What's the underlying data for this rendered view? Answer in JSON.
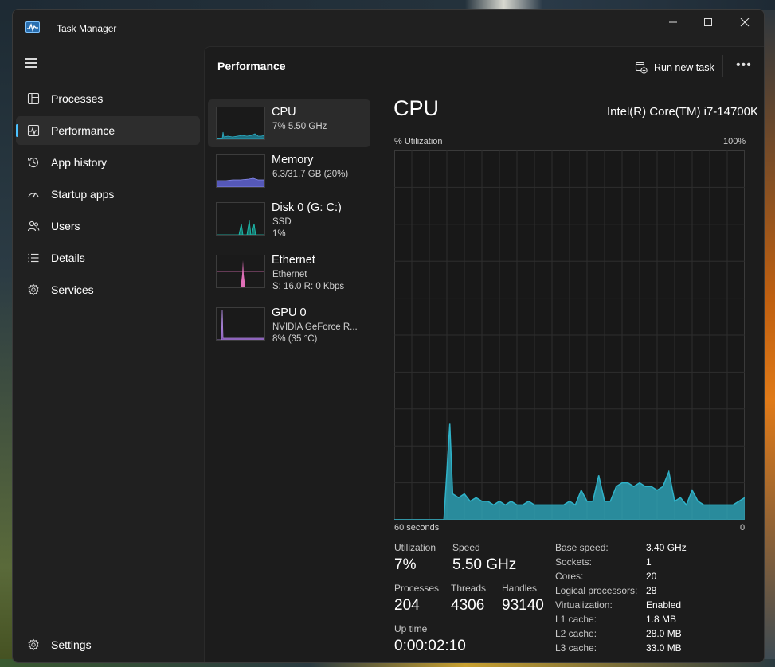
{
  "app": {
    "title": "Task Manager"
  },
  "window_controls": {
    "minimize": "—",
    "maximize": "☐",
    "close": "✕"
  },
  "sidebar": {
    "items": [
      {
        "label": "Processes",
        "icon": "processes-icon"
      },
      {
        "label": "Performance",
        "icon": "performance-icon",
        "active": true
      },
      {
        "label": "App history",
        "icon": "history-icon"
      },
      {
        "label": "Startup apps",
        "icon": "startup-icon"
      },
      {
        "label": "Users",
        "icon": "users-icon"
      },
      {
        "label": "Details",
        "icon": "details-icon"
      },
      {
        "label": "Services",
        "icon": "services-icon"
      }
    ],
    "settings": {
      "label": "Settings",
      "icon": "gear-icon"
    }
  },
  "header": {
    "title": "Performance",
    "run_new_task": "Run new task",
    "more": "•••"
  },
  "resources": [
    {
      "name": "CPU",
      "line1": "7%  5.50 GHz",
      "line2": "",
      "color": "#2fb2c8"
    },
    {
      "name": "Memory",
      "line1": "6.3/31.7 GB (20%)",
      "line2": "",
      "color": "#6b6fd8"
    },
    {
      "name": "Disk 0 (G: C:)",
      "line1": "SSD",
      "line2": "1%",
      "color": "#1fa59a"
    },
    {
      "name": "Ethernet",
      "line1": "Ethernet",
      "line2": "S: 16.0  R: 0 Kbps",
      "color": "#e06fb8"
    },
    {
      "name": "GPU 0",
      "line1": "NVIDIA GeForce R...",
      "line2": "8%  (35 °C)",
      "color": "#9a68c8"
    }
  ],
  "cpu": {
    "title": "CPU",
    "model": "Intel(R) Core(TM) i7-14700K",
    "y_label": "% Utilization",
    "y_max_label": "100%",
    "x_left_label": "60 seconds",
    "x_right_label": "0"
  },
  "chart_data": {
    "type": "area",
    "title": "",
    "xlabel": "60 seconds",
    "ylabel": "% Utilization",
    "ylim": [
      0,
      100
    ],
    "xlim": [
      60,
      0
    ],
    "grid": true,
    "series": [
      {
        "color": "#2fb2c8",
        "x": [
          60,
          58,
          56,
          54,
          52,
          51.5,
          50.5,
          50,
          49,
          48,
          47,
          46,
          45,
          44,
          43,
          42,
          41,
          40,
          39,
          38,
          37,
          36,
          35,
          34,
          33,
          32,
          31,
          30,
          29,
          28,
          27,
          26,
          25,
          24,
          23,
          22,
          21,
          20,
          19,
          18,
          17,
          16,
          15,
          14,
          13,
          12,
          11,
          10,
          9,
          8,
          7,
          6,
          5,
          4,
          3,
          2,
          1,
          0
        ],
        "y": [
          0,
          0,
          0,
          0,
          0,
          0,
          26,
          7,
          6,
          7,
          5,
          6,
          5,
          5,
          4,
          5,
          4,
          5,
          4,
          4,
          5,
          4,
          4,
          4,
          4,
          4,
          4,
          5,
          4,
          8,
          5,
          5,
          12,
          5,
          5,
          9,
          10,
          10,
          9,
          10,
          9,
          9,
          8,
          9,
          13,
          5,
          6,
          4,
          8,
          5,
          4,
          4,
          4,
          4,
          4,
          4,
          5,
          6
        ]
      }
    ]
  },
  "stats": {
    "utilization": {
      "label": "Utilization",
      "value": "7%"
    },
    "speed": {
      "label": "Speed",
      "value": "5.50 GHz"
    },
    "processes": {
      "label": "Processes",
      "value": "204"
    },
    "threads": {
      "label": "Threads",
      "value": "4306"
    },
    "handles": {
      "label": "Handles",
      "value": "93140"
    },
    "uptime": {
      "label": "Up time",
      "value": "0:00:02:10"
    }
  },
  "specs": [
    {
      "label": "Base speed:",
      "value": "3.40 GHz"
    },
    {
      "label": "Sockets:",
      "value": "1"
    },
    {
      "label": "Cores:",
      "value": "20"
    },
    {
      "label": "Logical processors:",
      "value": "28"
    },
    {
      "label": "Virtualization:",
      "value": "Enabled"
    },
    {
      "label": "L1 cache:",
      "value": "1.8 MB"
    },
    {
      "label": "L2 cache:",
      "value": "28.0 MB"
    },
    {
      "label": "L3 cache:",
      "value": "33.0 MB"
    }
  ]
}
